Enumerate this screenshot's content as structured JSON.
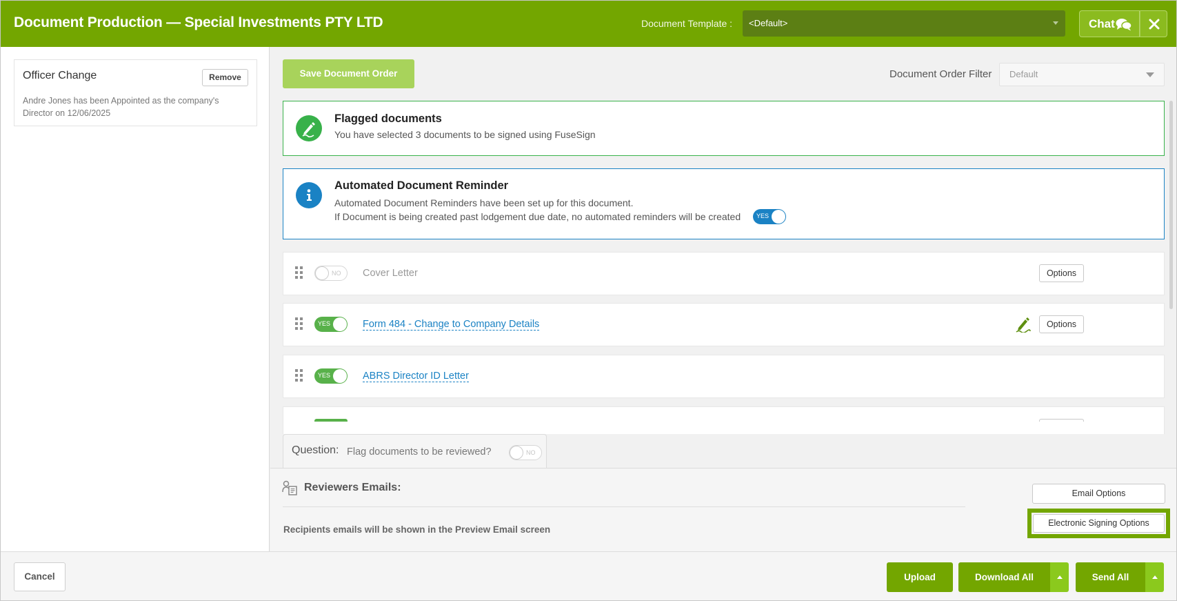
{
  "header": {
    "title": "Document Production — Special Investments PTY LTD",
    "template_label": "Document Template :",
    "template_value": "<Default>",
    "chat_label": "Chat"
  },
  "left_panel": {
    "change": {
      "title": "Officer Change",
      "remove_label": "Remove",
      "description": "Andre Jones has been Appointed as the company's Director on 12/06/2025"
    }
  },
  "toolbar": {
    "save_order_label": "Save Document Order",
    "filter_label": "Document Order Filter",
    "filter_value": "Default"
  },
  "flagged": {
    "title": "Flagged documents",
    "text": "You have selected 3 documents to be signed using FuseSign"
  },
  "reminder": {
    "title": "Automated Document Reminder",
    "line1": "Automated Document Reminders have been set up for this document.",
    "line2": "If Document is being created past lodgement due date, no automated reminders will be created",
    "toggle_label": "YES"
  },
  "documents": [
    {
      "name": "Cover Letter",
      "toggle": "NO",
      "options_label": "Options"
    },
    {
      "name": "Form 484 - Change to Company Details",
      "toggle": "YES",
      "options_label": "Options"
    },
    {
      "name": "ABRS Director ID Letter",
      "toggle": "YES"
    }
  ],
  "question": {
    "label": "Question:",
    "text": "Flag documents to be reviewed?",
    "toggle_label": "NO"
  },
  "reviewers": {
    "title": "Reviewers Emails:",
    "note": "Recipients emails will be shown in the Preview Email screen",
    "email_options_label": "Email Options",
    "esign_options_label": "Electronic Signing Options"
  },
  "footer": {
    "cancel_label": "Cancel",
    "upload_label": "Upload",
    "download_label": "Download All",
    "send_label": "Send All"
  },
  "colors": {
    "brand_green": "#73a600",
    "flag_green": "#38b14a",
    "info_blue": "#1a82c4"
  },
  "icons": [
    "chat-bubbles-icon",
    "close-icon",
    "signature-pen-icon",
    "info-icon",
    "drag-handle-icon",
    "reviewer-icon"
  ]
}
